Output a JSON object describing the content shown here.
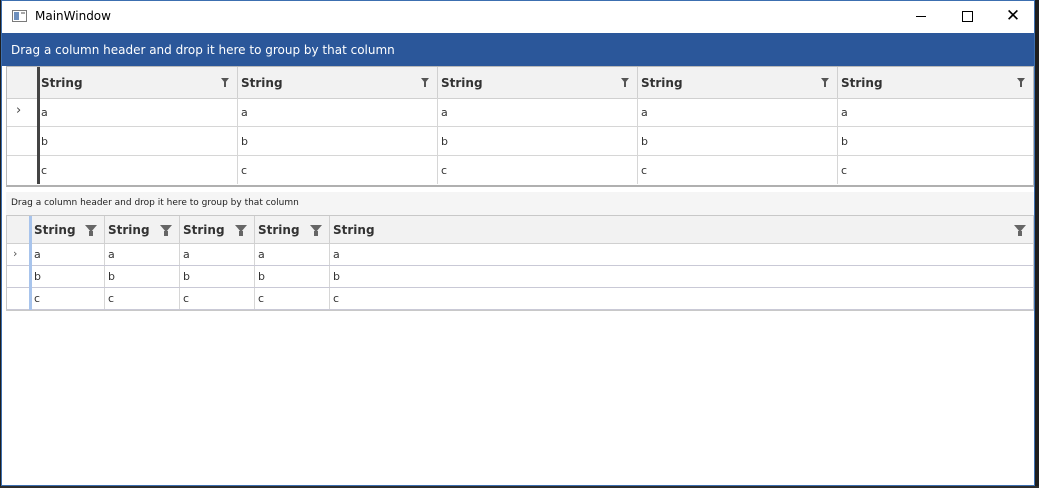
{
  "window": {
    "title": "MainWindow",
    "controls": {
      "minimize": "minimize",
      "maximize": "maximize",
      "close": "close"
    }
  },
  "grid1": {
    "group_panel_text": "Drag a column header and drop it here to group by that column",
    "columns": [
      "String",
      "String",
      "String",
      "String",
      "String"
    ],
    "rows": [
      [
        "a",
        "a",
        "a",
        "a",
        "a"
      ],
      [
        "b",
        "b",
        "b",
        "b",
        "b"
      ],
      [
        "c",
        "c",
        "c",
        "c",
        "c"
      ]
    ],
    "current_row_marker": "›"
  },
  "grid2": {
    "group_panel_text": "Drag a column header and drop it here to group by that column",
    "columns": [
      "String",
      "String",
      "String",
      "String",
      "String"
    ],
    "rows": [
      [
        "a",
        "a",
        "a",
        "a",
        "a"
      ],
      [
        "b",
        "b",
        "b",
        "b",
        "b"
      ],
      [
        "c",
        "c",
        "c",
        "c",
        "c"
      ]
    ],
    "current_row_marker": "›"
  },
  "colors": {
    "group_panel_blue": "#2b579a",
    "frozen_bar_dark": "#444444",
    "frozen_bar_light": "#a8c4ec"
  }
}
